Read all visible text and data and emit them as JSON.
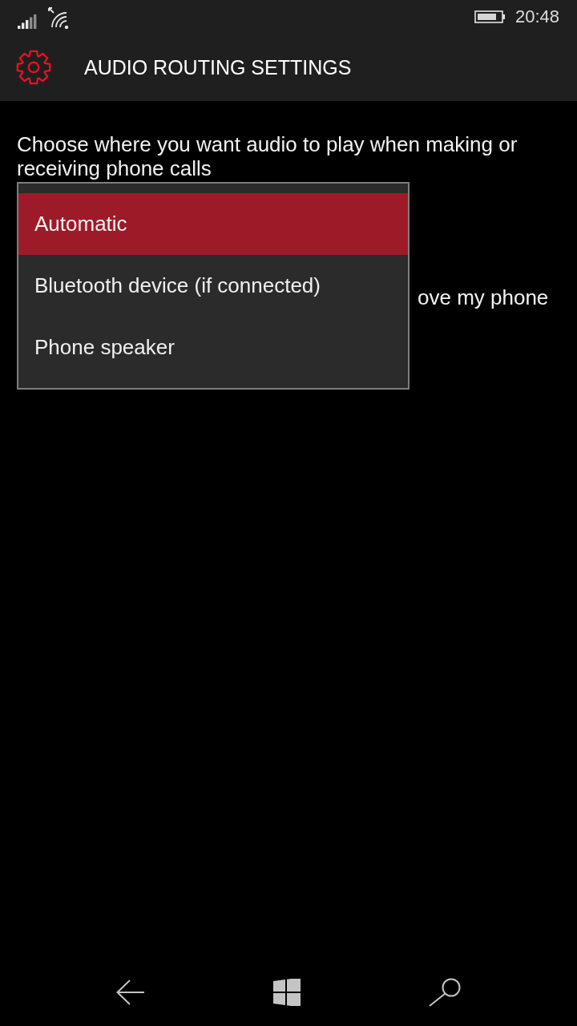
{
  "status_bar": {
    "time": "20:48"
  },
  "header": {
    "title": "AUDIO ROUTING SETTINGS"
  },
  "description": "Choose where you want audio to play when making or receiving phone calls",
  "covered_label": "ove my phone",
  "dropdown": {
    "options": [
      {
        "label": "Automatic",
        "selected": true
      },
      {
        "label": "Bluetooth device (if connected)",
        "selected": false
      },
      {
        "label": "Phone speaker",
        "selected": false
      }
    ]
  }
}
